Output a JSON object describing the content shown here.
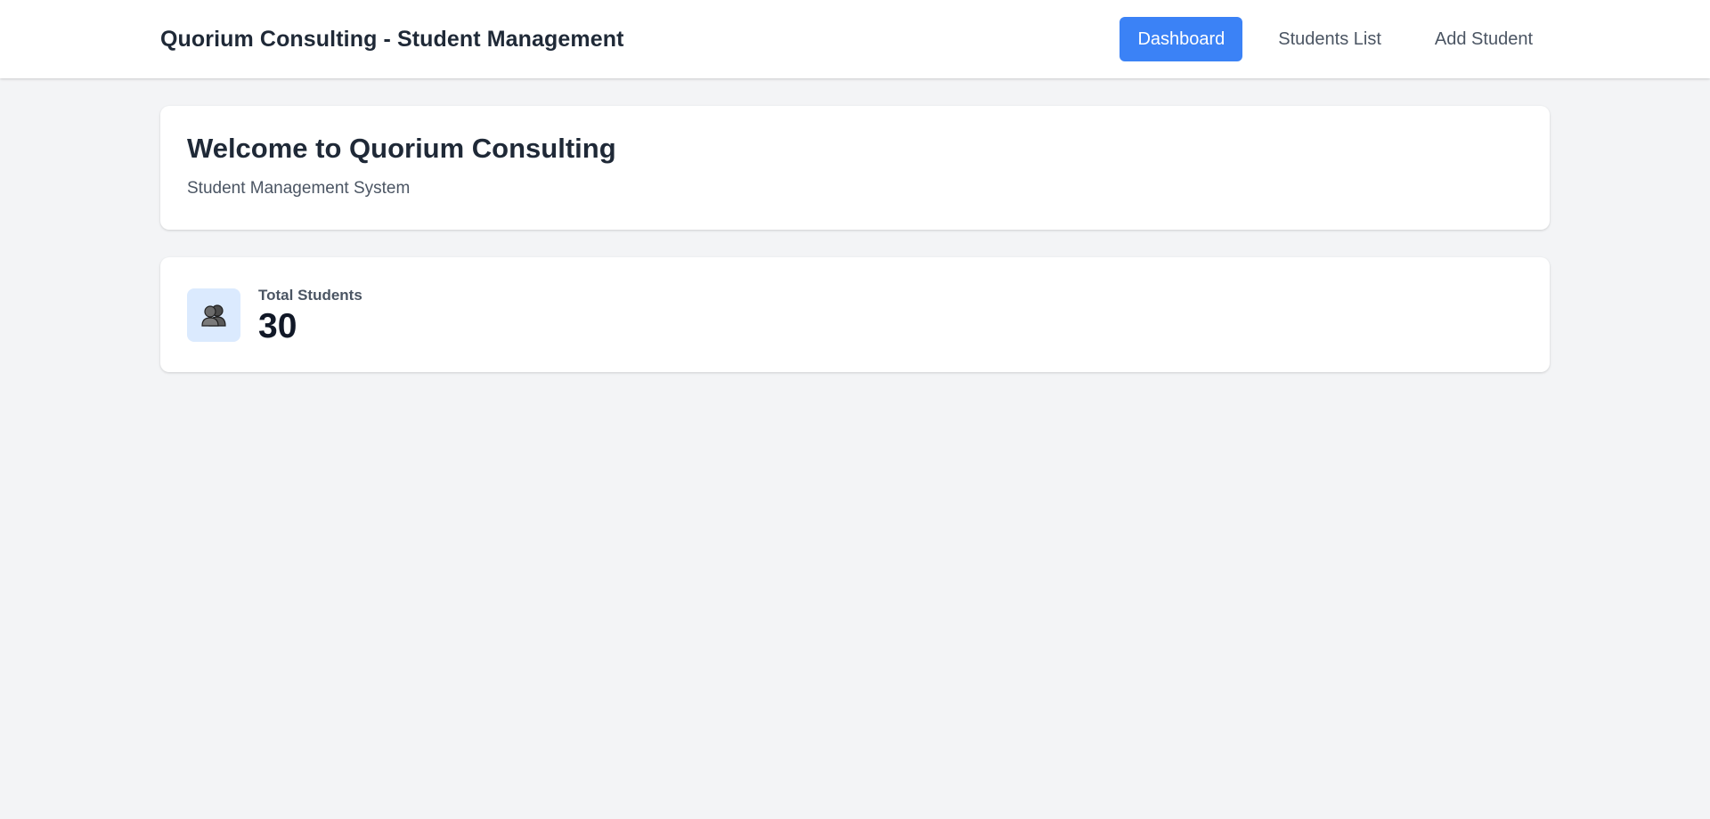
{
  "header": {
    "brand": "Quorium Consulting - Student Management",
    "nav": [
      {
        "label": "Dashboard",
        "active": true
      },
      {
        "label": "Students List",
        "active": false
      },
      {
        "label": "Add Student",
        "active": false
      }
    ]
  },
  "welcome": {
    "title": "Welcome to Quorium Consulting",
    "subtitle": "Student Management System"
  },
  "stats": {
    "total_students_label": "Total Students",
    "total_students_value": "30",
    "icon": "students-icon"
  },
  "colors": {
    "accent": "#3b82f6",
    "background": "#f3f4f6",
    "icon_bg": "#dbeafe"
  }
}
